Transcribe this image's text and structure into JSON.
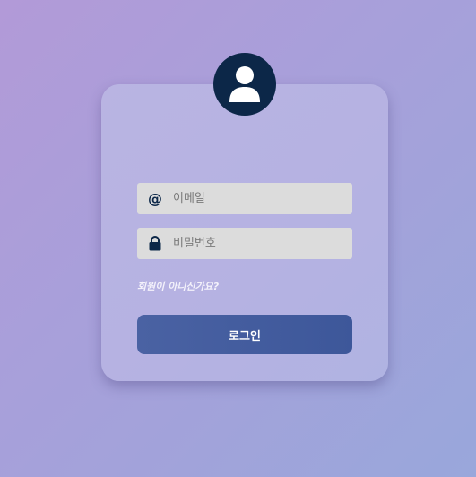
{
  "login": {
    "avatar_icon": "user-icon",
    "email": {
      "icon": "at-icon",
      "icon_glyph": "@",
      "placeholder": "이메일",
      "value": ""
    },
    "password": {
      "icon": "lock-icon",
      "placeholder": "비밀번호",
      "value": ""
    },
    "signup_link": "회원이 아니신가요?",
    "submit_label": "로그인"
  },
  "colors": {
    "background_start": "#b29ad8",
    "background_end": "#99a7db",
    "card": "#b7b3e2",
    "avatar": "#0c2748",
    "input_bg": "#dcdcdc",
    "button": "#4660a1",
    "button_text": "#ffffff"
  }
}
